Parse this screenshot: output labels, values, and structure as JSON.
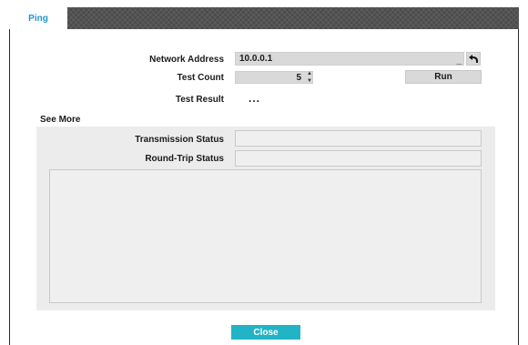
{
  "tabs": [
    {
      "label": "Ping"
    }
  ],
  "form": {
    "network_address_label": "Network Address",
    "network_address_value": "10.0.0.1",
    "test_count_label": "Test Count",
    "test_count_value": "5",
    "run_label": "Run",
    "test_result_label": "Test Result",
    "test_result_value": "..."
  },
  "see_more": {
    "label": "See More",
    "transmission_status_label": "Transmission Status",
    "transmission_status_value": "",
    "round_trip_status_label": "Round-Trip Status",
    "round_trip_status_value": "",
    "log_output": ""
  },
  "footer": {
    "close_label": "Close"
  },
  "icons": {
    "undo": "undo-arrow-icon",
    "spin_up": "spin-up-icon",
    "spin_down": "spin-down-icon"
  },
  "colors": {
    "accent": "#1f95c8",
    "close_button": "#23b3c6",
    "tab_bar": "#4a4a4a"
  }
}
